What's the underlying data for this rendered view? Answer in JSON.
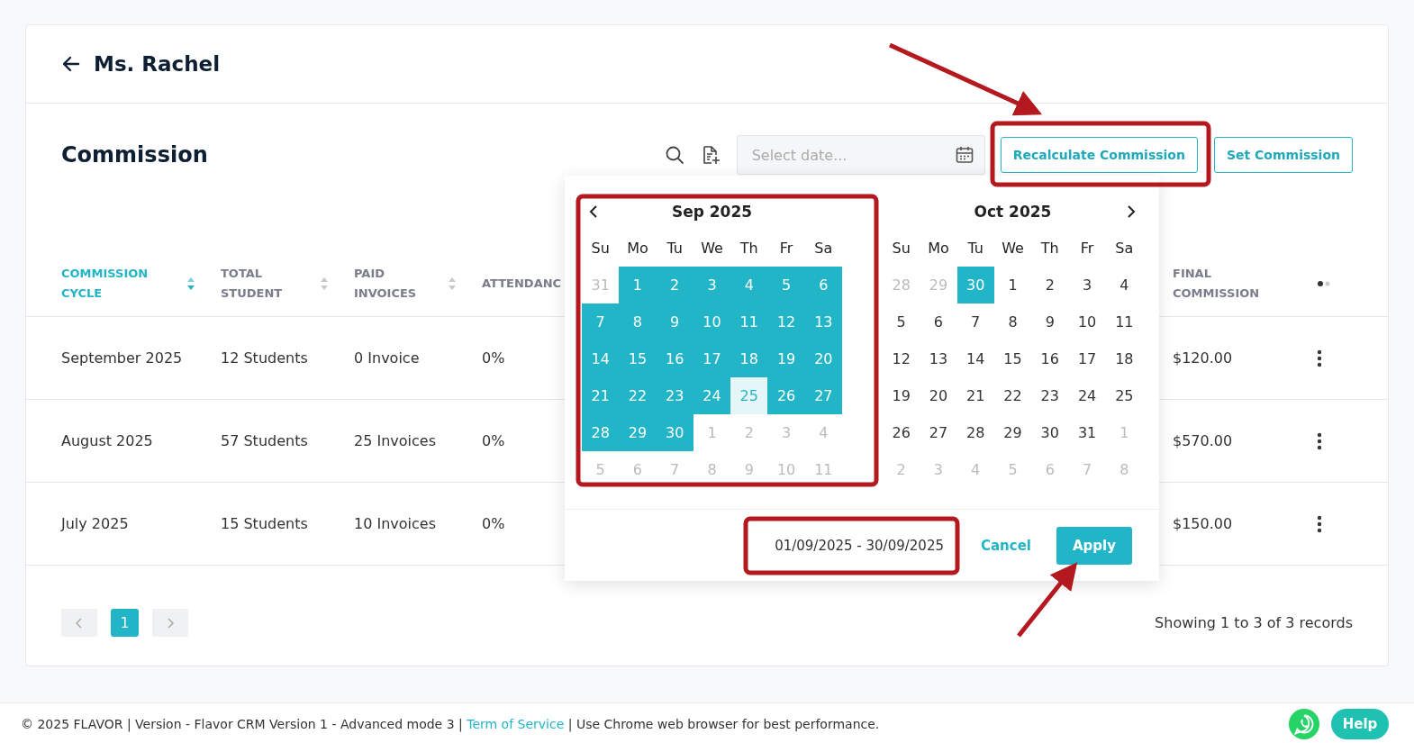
{
  "header": {
    "title": "Ms. Rachel"
  },
  "section": {
    "title": "Commission",
    "date_field": {
      "placeholder": "Select date..."
    },
    "buttons": [
      {
        "label": "Recalculate Commission"
      },
      {
        "label": "Set Commission"
      }
    ]
  },
  "table": {
    "columns": [
      {
        "label": "COMMISSION CYCLE",
        "sortable": true,
        "sorted": true
      },
      {
        "label": "TOTAL STUDENT",
        "sortable": true,
        "sorted": false
      },
      {
        "label": "PAID INVOICES",
        "sortable": true,
        "sorted": false
      },
      {
        "label": "ATTENDANC",
        "sortable": false,
        "sorted": false
      },
      {
        "label": "FINAL COMMISSION",
        "sortable": false,
        "sorted": false
      }
    ],
    "rows": [
      {
        "cells": [
          "September 2025",
          "12 Students",
          "0 Invoice",
          "0%",
          "$120.00"
        ]
      },
      {
        "cells": [
          "August 2025",
          "57 Students",
          "25 Invoices",
          "0%",
          "$570.00"
        ]
      },
      {
        "cells": [
          "July 2025",
          "15 Students",
          "10 Invoices",
          "0%",
          "$150.00"
        ]
      }
    ]
  },
  "date_picker": {
    "months": [
      {
        "title": "Sep 2025",
        "weekdays": [
          "Su",
          "Mo",
          "Tu",
          "We",
          "Th",
          "Fr",
          "Sa"
        ],
        "days": [
          {
            "label": "31",
            "muted": true,
            "selected": false,
            "today": false
          },
          {
            "label": "1",
            "muted": false,
            "selected": true,
            "today": false
          },
          {
            "label": "2",
            "muted": false,
            "selected": true,
            "today": false
          },
          {
            "label": "3",
            "muted": false,
            "selected": true,
            "today": false
          },
          {
            "label": "4",
            "muted": false,
            "selected": true,
            "today": false
          },
          {
            "label": "5",
            "muted": false,
            "selected": true,
            "today": false
          },
          {
            "label": "6",
            "muted": false,
            "selected": true,
            "today": false
          },
          {
            "label": "7",
            "muted": false,
            "selected": true,
            "today": false
          },
          {
            "label": "8",
            "muted": false,
            "selected": true,
            "today": false
          },
          {
            "label": "9",
            "muted": false,
            "selected": true,
            "today": false
          },
          {
            "label": "10",
            "muted": false,
            "selected": true,
            "today": false
          },
          {
            "label": "11",
            "muted": false,
            "selected": true,
            "today": false
          },
          {
            "label": "12",
            "muted": false,
            "selected": true,
            "today": false
          },
          {
            "label": "13",
            "muted": false,
            "selected": true,
            "today": false
          },
          {
            "label": "14",
            "muted": false,
            "selected": true,
            "today": false
          },
          {
            "label": "15",
            "muted": false,
            "selected": true,
            "today": false
          },
          {
            "label": "16",
            "muted": false,
            "selected": true,
            "today": false
          },
          {
            "label": "17",
            "muted": false,
            "selected": true,
            "today": false
          },
          {
            "label": "18",
            "muted": false,
            "selected": true,
            "today": false
          },
          {
            "label": "19",
            "muted": false,
            "selected": true,
            "today": false
          },
          {
            "label": "20",
            "muted": false,
            "selected": true,
            "today": false
          },
          {
            "label": "21",
            "muted": false,
            "selected": true,
            "today": false
          },
          {
            "label": "22",
            "muted": false,
            "selected": true,
            "today": false
          },
          {
            "label": "23",
            "muted": false,
            "selected": true,
            "today": false
          },
          {
            "label": "24",
            "muted": false,
            "selected": true,
            "today": false
          },
          {
            "label": "25",
            "muted": false,
            "selected": false,
            "today": true
          },
          {
            "label": "26",
            "muted": false,
            "selected": true,
            "today": false
          },
          {
            "label": "27",
            "muted": false,
            "selected": true,
            "today": false
          },
          {
            "label": "28",
            "muted": false,
            "selected": true,
            "today": false
          },
          {
            "label": "29",
            "muted": false,
            "selected": true,
            "today": false
          },
          {
            "label": "30",
            "muted": false,
            "selected": true,
            "today": false
          },
          {
            "label": "1",
            "muted": true,
            "selected": false,
            "today": false
          },
          {
            "label": "2",
            "muted": true,
            "selected": false,
            "today": false
          },
          {
            "label": "3",
            "muted": true,
            "selected": false,
            "today": false
          },
          {
            "label": "4",
            "muted": true,
            "selected": false,
            "today": false
          },
          {
            "label": "5",
            "muted": true,
            "selected": false,
            "today": false
          },
          {
            "label": "6",
            "muted": true,
            "selected": false,
            "today": false
          },
          {
            "label": "7",
            "muted": true,
            "selected": false,
            "today": false
          },
          {
            "label": "8",
            "muted": true,
            "selected": false,
            "today": false
          },
          {
            "label": "9",
            "muted": true,
            "selected": false,
            "today": false
          },
          {
            "label": "10",
            "muted": true,
            "selected": false,
            "today": false
          },
          {
            "label": "11",
            "muted": true,
            "selected": false,
            "today": false
          }
        ]
      },
      {
        "title": "Oct 2025",
        "weekdays": [
          "Su",
          "Mo",
          "Tu",
          "We",
          "Th",
          "Fr",
          "Sa"
        ],
        "days": [
          {
            "label": "28",
            "muted": true,
            "selected": false,
            "today": false
          },
          {
            "label": "29",
            "muted": true,
            "selected": false,
            "today": false
          },
          {
            "label": "30",
            "muted": true,
            "selected": true,
            "today": false
          },
          {
            "label": "1",
            "muted": false,
            "selected": false,
            "today": false
          },
          {
            "label": "2",
            "muted": false,
            "selected": false,
            "today": false
          },
          {
            "label": "3",
            "muted": false,
            "selected": false,
            "today": false
          },
          {
            "label": "4",
            "muted": false,
            "selected": false,
            "today": false
          },
          {
            "label": "5",
            "muted": false,
            "selected": false,
            "today": false
          },
          {
            "label": "6",
            "muted": false,
            "selected": false,
            "today": false
          },
          {
            "label": "7",
            "muted": false,
            "selected": false,
            "today": false
          },
          {
            "label": "8",
            "muted": false,
            "selected": false,
            "today": false
          },
          {
            "label": "9",
            "muted": false,
            "selected": false,
            "today": false
          },
          {
            "label": "10",
            "muted": false,
            "selected": false,
            "today": false
          },
          {
            "label": "11",
            "muted": false,
            "selected": false,
            "today": false
          },
          {
            "label": "12",
            "muted": false,
            "selected": false,
            "today": false
          },
          {
            "label": "13",
            "muted": false,
            "selected": false,
            "today": false
          },
          {
            "label": "14",
            "muted": false,
            "selected": false,
            "today": false
          },
          {
            "label": "15",
            "muted": false,
            "selected": false,
            "today": false
          },
          {
            "label": "16",
            "muted": false,
            "selected": false,
            "today": false
          },
          {
            "label": "17",
            "muted": false,
            "selected": false,
            "today": false
          },
          {
            "label": "18",
            "muted": false,
            "selected": false,
            "today": false
          },
          {
            "label": "19",
            "muted": false,
            "selected": false,
            "today": false
          },
          {
            "label": "20",
            "muted": false,
            "selected": false,
            "today": false
          },
          {
            "label": "21",
            "muted": false,
            "selected": false,
            "today": false
          },
          {
            "label": "22",
            "muted": false,
            "selected": false,
            "today": false
          },
          {
            "label": "23",
            "muted": false,
            "selected": false,
            "today": false
          },
          {
            "label": "24",
            "muted": false,
            "selected": false,
            "today": false
          },
          {
            "label": "25",
            "muted": false,
            "selected": false,
            "today": false
          },
          {
            "label": "26",
            "muted": false,
            "selected": false,
            "today": false
          },
          {
            "label": "27",
            "muted": false,
            "selected": false,
            "today": false
          },
          {
            "label": "28",
            "muted": false,
            "selected": false,
            "today": false
          },
          {
            "label": "29",
            "muted": false,
            "selected": false,
            "today": false
          },
          {
            "label": "30",
            "muted": false,
            "selected": false,
            "today": false
          },
          {
            "label": "31",
            "muted": false,
            "selected": false,
            "today": false
          },
          {
            "label": "1",
            "muted": true,
            "selected": false,
            "today": false
          },
          {
            "label": "2",
            "muted": true,
            "selected": false,
            "today": false
          },
          {
            "label": "3",
            "muted": true,
            "selected": false,
            "today": false
          },
          {
            "label": "4",
            "muted": true,
            "selected": false,
            "today": false
          },
          {
            "label": "5",
            "muted": true,
            "selected": false,
            "today": false
          },
          {
            "label": "6",
            "muted": true,
            "selected": false,
            "today": false
          },
          {
            "label": "7",
            "muted": true,
            "selected": false,
            "today": false
          },
          {
            "label": "8",
            "muted": true,
            "selected": false,
            "today": false
          }
        ]
      }
    ],
    "range": "01/09/2025 - 30/09/2025",
    "cancel": "Cancel",
    "apply": "Apply"
  },
  "pagination": {
    "pages": [
      {
        "label": "1",
        "selected": true
      }
    ],
    "summary": "Showing 1 to 3 of 3 records"
  },
  "footer": {
    "text_before": "© 2025 FLAVOR | Version - Flavor CRM Version 1 - Advanced mode 3 | ",
    "link": "Term of Service",
    "text_after": " | Use Chrome web browser for best performance.",
    "help": "Help"
  }
}
